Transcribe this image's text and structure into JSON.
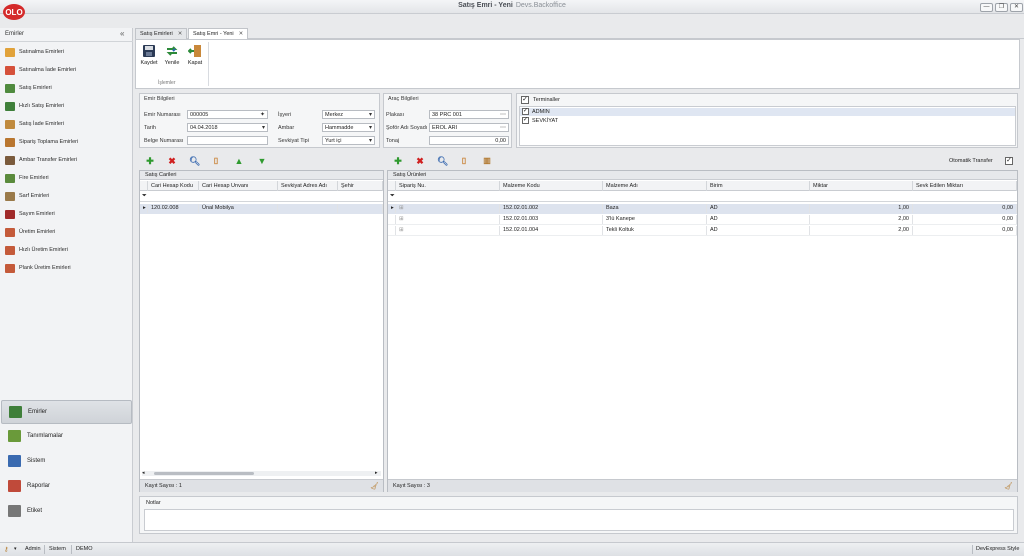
{
  "window": {
    "title": "Satış Emri - Yeni",
    "subtitle": "Devs.Backoffice",
    "logo_text": "OLO",
    "minimize": "—",
    "restore": "❐",
    "close": "✕"
  },
  "sidebar": {
    "header": "Emirler",
    "collapse_glyph": "«",
    "items": [
      {
        "label": "Satınalma Emirleri",
        "icon": "purchase-icon",
        "color": "#e1a23a"
      },
      {
        "label": "Satınalma İade Emirleri",
        "icon": "purchase-return-icon",
        "color": "#d5503a"
      },
      {
        "label": "Satış Emirleri",
        "icon": "sales-truck-icon",
        "color": "#4f8a3e"
      },
      {
        "label": "Hızlı Satış Emirleri",
        "icon": "fast-sales-icon",
        "color": "#3f7f3a"
      },
      {
        "label": "Satış İade Emirleri",
        "icon": "sales-return-icon",
        "color": "#c08a3e"
      },
      {
        "label": "Sipariş Toplama Emirleri",
        "icon": "order-pick-icon",
        "color": "#b9762f"
      },
      {
        "label": "Ambar Transfer Emirleri",
        "icon": "warehouse-transfer-icon",
        "color": "#7a5a3c"
      },
      {
        "label": "Fire Emirleri",
        "icon": "waste-icon",
        "color": "#5a8a3c"
      },
      {
        "label": "Sarf Emirleri",
        "icon": "consumption-icon",
        "color": "#9a7a4a"
      },
      {
        "label": "Sayım Emirleri",
        "icon": "count-icon",
        "color": "#a02a2a"
      },
      {
        "label": "Üretim Emirleri",
        "icon": "production-icon",
        "color": "#c45a3a"
      },
      {
        "label": "Hızlı Üretim Emirleri",
        "icon": "fast-production-icon",
        "color": "#c45a3a"
      },
      {
        "label": "Plank Üretim Emirleri",
        "icon": "plank-production-icon",
        "color": "#c45a3a"
      }
    ],
    "groups": [
      {
        "label": "Emirler",
        "icon": "orders-icon",
        "color": "#3f7f3a",
        "active": true
      },
      {
        "label": "Tanımlamalar",
        "icon": "definitions-icon",
        "color": "#6a9a3a",
        "active": false
      },
      {
        "label": "Sistem",
        "icon": "system-icon",
        "color": "#3a6ab0",
        "active": false
      },
      {
        "label": "Raporlar",
        "icon": "reports-icon",
        "color": "#c04a3a",
        "active": false
      },
      {
        "label": "Etiket",
        "icon": "label-icon",
        "color": "#777777",
        "active": false
      }
    ]
  },
  "tabs": [
    {
      "label": "Satış Emirleri",
      "close": "✕",
      "active": false
    },
    {
      "label": "Satış Emri - Yeni",
      "close": "✕",
      "active": true
    }
  ],
  "ribbon": {
    "buttons": [
      {
        "label": "Kaydet",
        "icon": "save-icon"
      },
      {
        "label": "Yenile",
        "icon": "refresh-icon"
      },
      {
        "label": "Kapat",
        "icon": "close-door-icon"
      }
    ],
    "group_label": "İşlemler"
  },
  "emir_bilgileri": {
    "title": "Emir Bilgileri",
    "emir_numarasi_label": "Emir Numarası",
    "emir_numarasi": "000005",
    "tarih_label": "Tarih",
    "tarih": "04.04.2018",
    "belge_numarasi_label": "Belge Numarası",
    "belge_numarasi": "",
    "isyeri_label": "İşyeri",
    "isyeri": "Merkez",
    "ambar_label": "Ambar",
    "ambar": "Hammadde",
    "sevkiyat_tipi_label": "Sevkiyat Tipi",
    "sevkiyat_tipi": "Yurt içi"
  },
  "arac_bilgileri": {
    "title": "Araç Bilgileri",
    "plakasi_label": "Plakası",
    "plakasi": "38 PRC 001",
    "sofor_label": "Şoför Adı Soyadı",
    "sofor": "EROL ARI",
    "tonaj_label": "Tonaj",
    "tonaj": "0,00"
  },
  "terminaller": {
    "title": "Terminaller",
    "items": [
      "ADMIN",
      "SEVKİYAT"
    ]
  },
  "otomatik_transfer": {
    "label": "Otomatik Transfer",
    "checked": true
  },
  "satis_carileri": {
    "caption": "Satış Carileri",
    "columns": [
      "Cari Hesap Kodu",
      "Cari Hesap Unvanı",
      "Sevkiyat Adres Adı",
      "Şehir"
    ],
    "rows": [
      [
        "120.02.008",
        "Ünal Mobilya",
        "",
        ""
      ]
    ],
    "footer": "Kayıt Sayısı : 1"
  },
  "satis_urunleri": {
    "caption": "Satış Ürünleri",
    "columns": [
      "Sipariş Nu.",
      "Malzeme Kodu",
      "Malzeme Adı",
      "Birim",
      "Miktar",
      "Sevk Edilen Miktarı"
    ],
    "rows": [
      [
        "",
        "152.02.01.002",
        "Baza",
        "AD",
        "1,00",
        "0,00"
      ],
      [
        "",
        "152.02.01.003",
        "3'lü Kanepe",
        "AD",
        "2,00",
        "0,00"
      ],
      [
        "",
        "152.02.01.004",
        "Tekli Koltuk",
        "AD",
        "2,00",
        "0,00"
      ]
    ],
    "footer": "Kayıt Sayısı : 3"
  },
  "notes": {
    "title": "Notlar"
  },
  "statusbar": {
    "user": "Admin",
    "company": "Sistem",
    "db": "DEMO",
    "style": "DevExpress Style"
  }
}
